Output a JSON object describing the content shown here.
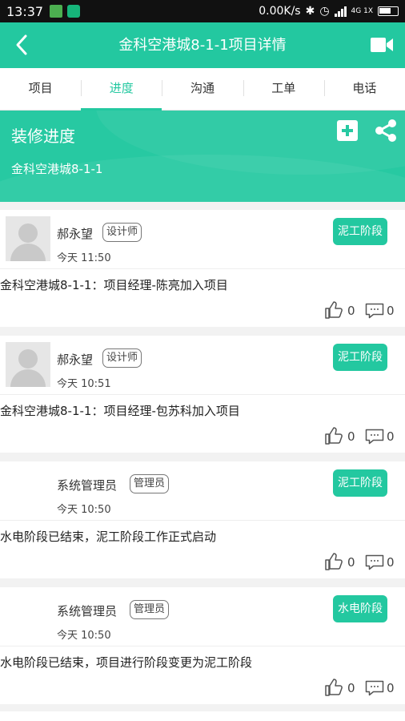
{
  "status_bar": {
    "time": "13:37",
    "network_speed": "0.00K/s",
    "signal_label": "4G 1X"
  },
  "header": {
    "title": "金科空港城8-1-1项目详情",
    "back_icon": "chevron-left-icon",
    "video_icon": "video-camera-icon"
  },
  "tabs": [
    {
      "label": "项目",
      "active": false
    },
    {
      "label": "进度",
      "active": true
    },
    {
      "label": "沟通",
      "active": false
    },
    {
      "label": "工单",
      "active": false
    },
    {
      "label": "电话",
      "active": false
    }
  ],
  "banner": {
    "title": "装修进度",
    "subtitle": "金科空港城8-1-1"
  },
  "feed": [
    {
      "name": "郝永望",
      "role": "设计师",
      "time": "今天 11:50",
      "stage": "泥工阶段",
      "content": "金科空港城8-1-1：项目经理-陈亮加入项目",
      "likes": "0",
      "comments": "0",
      "avatar": "default"
    },
    {
      "name": "郝永望",
      "role": "设计师",
      "time": "今天 10:51",
      "stage": "泥工阶段",
      "content": "金科空港城8-1-1：项目经理-包苏科加入项目",
      "likes": "0",
      "comments": "0",
      "avatar": "default"
    },
    {
      "name": "系统管理员",
      "role": "管理员",
      "time": "今天 10:50",
      "stage": "泥工阶段",
      "content": "水电阶段已结束，泥工阶段工作正式启动",
      "likes": "0",
      "comments": "0",
      "avatar": "none"
    },
    {
      "name": "系统管理员",
      "role": "管理员",
      "time": "今天 10:50",
      "stage": "水电阶段",
      "content": "水电阶段已结束，项目进行阶段变更为泥工阶段",
      "likes": "0",
      "comments": "0",
      "avatar": "none"
    }
  ],
  "colors": {
    "accent": "#23c8a0",
    "status_bar": "#111111",
    "background": "#f2f2f2"
  }
}
